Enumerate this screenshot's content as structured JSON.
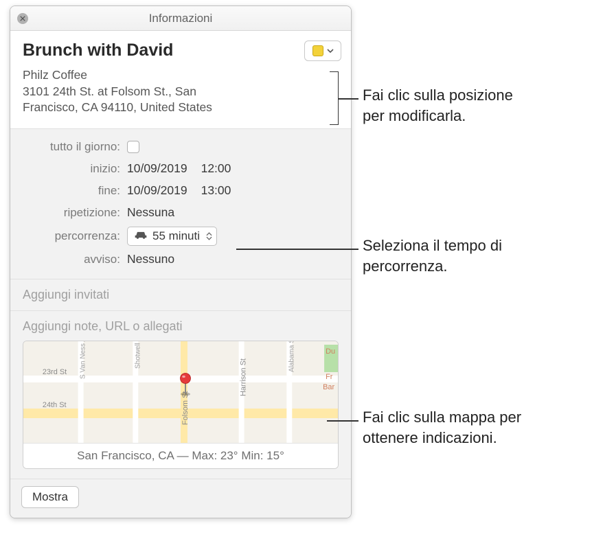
{
  "window": {
    "title": "Informazioni"
  },
  "event": {
    "title": "Brunch with David",
    "location_name": "Philz Coffee",
    "location_addr_line1": "3101 24th St. at Folsom St., San",
    "location_addr_line2": "Francisco, CA 94110, United States"
  },
  "details": {
    "allday_label": "tutto il giorno:",
    "start_label": "inizio:",
    "start_date": "10/09/2019",
    "start_time": "12:00",
    "end_label": "fine:",
    "end_date": "10/09/2019",
    "end_time": "13:00",
    "repeat_label": "ripetizione:",
    "repeat_value": "Nessuna",
    "travel_label": "percorrenza:",
    "travel_value": "55 minuti",
    "alert_label": "avviso:",
    "alert_value": "Nessuno"
  },
  "invitees": {
    "placeholder": "Aggiungi invitati"
  },
  "notes": {
    "placeholder": "Aggiungi note, URL o allegati"
  },
  "map": {
    "footer": "San Francisco, CA — Max: 23° Min: 15°",
    "streets": {
      "s1": "23rd St",
      "s2": "24th St",
      "s3": "Folsom St",
      "s4": "Harrison St",
      "s5": "Shotwell St",
      "s6": "S Van Ness Ave",
      "s7": "Alabama St",
      "poi1": "Du",
      "poi2": "Fr",
      "poi3": "Bar"
    }
  },
  "buttons": {
    "show": "Mostra"
  },
  "callouts": {
    "c1_l1": "Fai clic sulla posizione",
    "c1_l2": "per modificarla.",
    "c2_l1": "Seleziona il tempo di",
    "c2_l2": "percorrenza.",
    "c3_l1": "Fai clic sulla mappa per",
    "c3_l2": "ottenere indicazioni."
  }
}
